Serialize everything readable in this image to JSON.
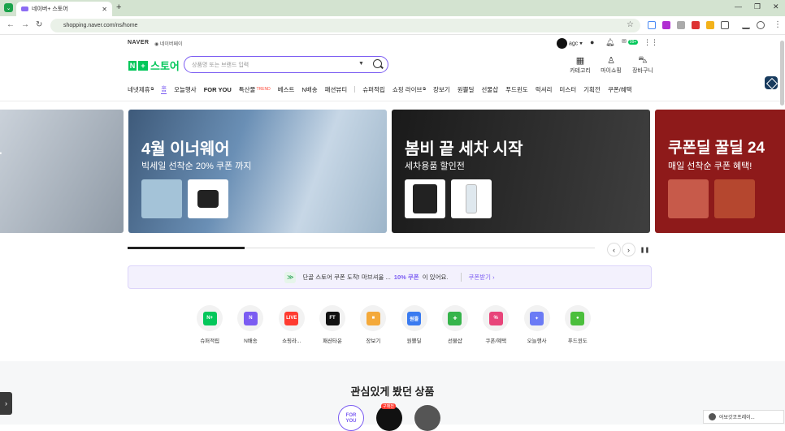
{
  "browser": {
    "tab_title": "네이버+ 스토어",
    "url": "shopping.naver.com/ns/home"
  },
  "header": {
    "naver": "NAVER",
    "npay": "네이버페이",
    "logo_n": "N",
    "logo_plus": "+",
    "logo_text": "스토어",
    "search_placeholder": "상품명 또는 브랜드 입력",
    "user_name": "agc",
    "user_tag": "agc",
    "badge_count": "99+",
    "icons": [
      {
        "label": "카테고리",
        "glyph": "▦",
        "icon": "category-icon"
      },
      {
        "label": "마이쇼핑",
        "glyph": "♙",
        "icon": "person-icon"
      },
      {
        "label": "장바구니",
        "glyph": "⛍",
        "icon": "cart-icon"
      }
    ]
  },
  "nav": [
    {
      "label": "네넷제휴",
      "ext": true
    },
    {
      "label": "홈",
      "active": true
    },
    {
      "label": "오늘행사"
    },
    {
      "label": "FOR YOU",
      "bold": true
    },
    {
      "label": "특산물",
      "sup": "TREND"
    },
    {
      "label": "베스트"
    },
    {
      "label": "N배송"
    },
    {
      "label": "패션뷰티"
    },
    {
      "sep": true
    },
    {
      "label": "슈퍼적립"
    },
    {
      "label": "쇼핑 라이브",
      "ext": true
    },
    {
      "label": "장보기"
    },
    {
      "label": "원쁠딜"
    },
    {
      "label": "선물샵"
    },
    {
      "label": "푸드윈도"
    },
    {
      "label": "럭셔리"
    },
    {
      "label": "미스터"
    },
    {
      "label": "기획전"
    },
    {
      "label": "쿠폰/혜택"
    }
  ],
  "banners": [
    {
      "title": "크",
      "subtitle": ""
    },
    {
      "title": "4월 이너웨어",
      "subtitle": "빅세일 선착순 20% 쿠폰 까지"
    },
    {
      "title": "봄비 끝 세차 시작",
      "subtitle": "세차용품 할인전"
    },
    {
      "title": "쿠폰딜 꿀딜 24",
      "subtitle": "매일 선착순 쿠폰 혜택!"
    }
  ],
  "carousel": {
    "progress": 0.25,
    "prev": "‹",
    "next": "›",
    "pause": "❚❚"
  },
  "notice": {
    "icon": "≫",
    "text_pre": "단골 스토어 쿠폰 도착! 마브셔울 ...",
    "highlight": "10% 쿠폰",
    "text_post": "이 있어요.",
    "link": "쿠폰받기 ›"
  },
  "categories": [
    {
      "label": "슈퍼적립",
      "icon_text": "N+",
      "color": "#03c75a",
      "icon": "super-point-icon"
    },
    {
      "label": "N배송",
      "icon_text": "N",
      "color": "#7b5cf2",
      "icon": "n-delivery-icon"
    },
    {
      "label": "쇼핑라...",
      "icon_text": "LIVE",
      "color": "#ff3b30",
      "icon": "live-icon"
    },
    {
      "label": "패션타운",
      "icon_text": "FT",
      "color": "#111111",
      "icon": "fashion-town-icon"
    },
    {
      "label": "장보기",
      "icon_text": "■",
      "color": "#f4a93a",
      "icon": "grocery-icon"
    },
    {
      "label": "원쁠딜",
      "icon_text": "원쁠",
      "color": "#3a7bf0",
      "icon": "oneplus-deal-icon"
    },
    {
      "label": "선물샵",
      "icon_text": "✚",
      "color": "#35b44a",
      "icon": "gift-icon"
    },
    {
      "label": "쿠폰/혜택",
      "icon_text": "%",
      "color": "#e8457a",
      "icon": "coupon-icon"
    },
    {
      "label": "오늘행사",
      "icon_text": "✦",
      "color": "#6b7bf5",
      "icon": "today-event-icon"
    },
    {
      "label": "푸드윈도",
      "icon_text": "●",
      "color": "#4bbf3c",
      "icon": "food-window-icon"
    }
  ],
  "section": {
    "title": "관심있게 봤던 상품"
  },
  "bottom": {
    "foryou": "FOR\nYOU",
    "badge": "구매전",
    "toast": "어보갓코프레이..."
  }
}
